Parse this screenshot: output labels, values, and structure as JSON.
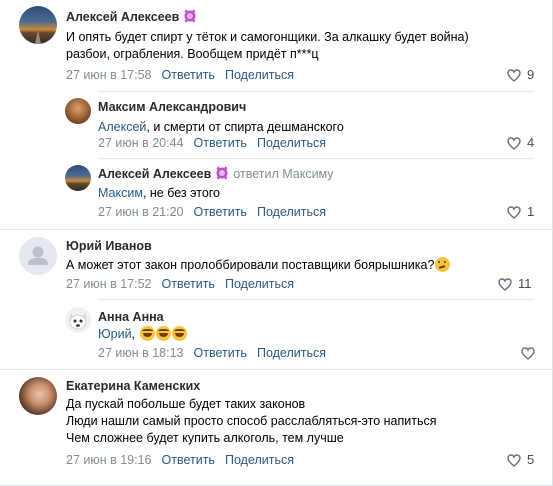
{
  "actions": {
    "reply": "Ответить",
    "share": "Поделиться"
  },
  "colors": {
    "link": "#2a5885",
    "meta": "#818c99",
    "badge": "#b94fc9"
  },
  "comments": [
    {
      "author": "Алексей Алексеев",
      "text": "И опять будет спирт у тёток и самогонщики. За алкашку будет война)\nразбои, ограбления. Вообщем придёт п***ц",
      "date": "27 июн в 17:58",
      "likes": "9"
    },
    {
      "author": "Максим Александрович",
      "mention": "Алексей",
      "text": ", и смерти от спирта дешманского",
      "date": "27 июн в 20:44",
      "likes": "4"
    },
    {
      "author": "Алексей Алексеев",
      "reply_to": "ответил Максиму",
      "mention": "Максим",
      "text": ", не без этого",
      "date": "27 июн в 21:20",
      "likes": "1"
    },
    {
      "author": "Юрий Иванов",
      "text": "А может этот закон пролоббировали поставщики боярышника?",
      "date": "27 июн в 17:52",
      "likes": "11"
    },
    {
      "author": "Анна Анна",
      "mention": "Юрий",
      "text": ", ",
      "date": "27 июн в 18:13",
      "likes": ""
    },
    {
      "author": "Екатерина Каменских",
      "text": "Да пускай побольше будет таких законов\nЛюди нашли самый просто способ расслабляться-это напиться\nЧем сложнее будет купить алкоголь, тем лучше",
      "date": "27 июн в 19:16",
      "likes": "5"
    }
  ]
}
